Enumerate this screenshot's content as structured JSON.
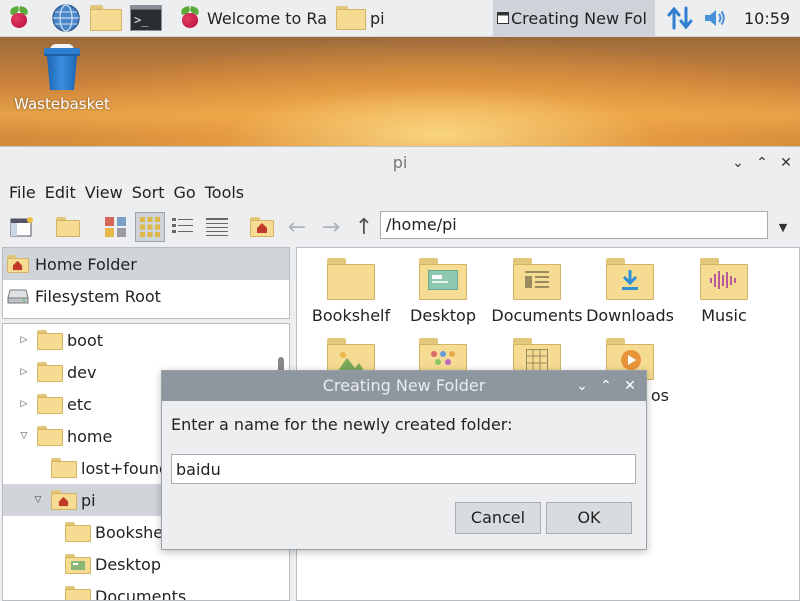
{
  "taskbar": {
    "tasks": [
      {
        "label": "Welcome to Ra"
      },
      {
        "label": "pi"
      },
      {
        "label": "Creating New Fol"
      }
    ],
    "clock": "10:59"
  },
  "desktop": {
    "wastebasket_label": "Wastebasket"
  },
  "file_manager": {
    "title": "pi",
    "menu": [
      "File",
      "Edit",
      "View",
      "Sort",
      "Go",
      "Tools"
    ],
    "path": "/home/pi",
    "places": [
      "Home Folder",
      "Filesystem Root"
    ],
    "tree": [
      {
        "label": "boot",
        "indent": 0,
        "arrow": "right"
      },
      {
        "label": "dev",
        "indent": 0,
        "arrow": "right"
      },
      {
        "label": "etc",
        "indent": 0,
        "arrow": "right"
      },
      {
        "label": "home",
        "indent": 0,
        "arrow": "down"
      },
      {
        "label": "lost+found",
        "indent": 1,
        "arrow": "none"
      },
      {
        "label": "pi",
        "indent": 1,
        "arrow": "down",
        "selected": true
      },
      {
        "label": "Bookshelf",
        "indent": 2,
        "arrow": "none"
      },
      {
        "label": "Desktop",
        "indent": 2,
        "arrow": "none"
      },
      {
        "label": "Documents",
        "indent": 2,
        "arrow": "none"
      }
    ],
    "icons": [
      "Bookshelf",
      "Desktop",
      "Documents",
      "Downloads",
      "Music",
      "",
      "",
      "",
      "os"
    ]
  },
  "dialog": {
    "title": "Creating New Folder",
    "prompt": "Enter a name for the newly created folder:",
    "input_value": "baidu",
    "cancel_label": "Cancel",
    "ok_label": "OK"
  },
  "colors": {
    "taskbar_bg": "#edeef0",
    "dialog_titlebar": "#8e979f",
    "selection": "#d1d5da",
    "folder": "#f6dc92"
  }
}
